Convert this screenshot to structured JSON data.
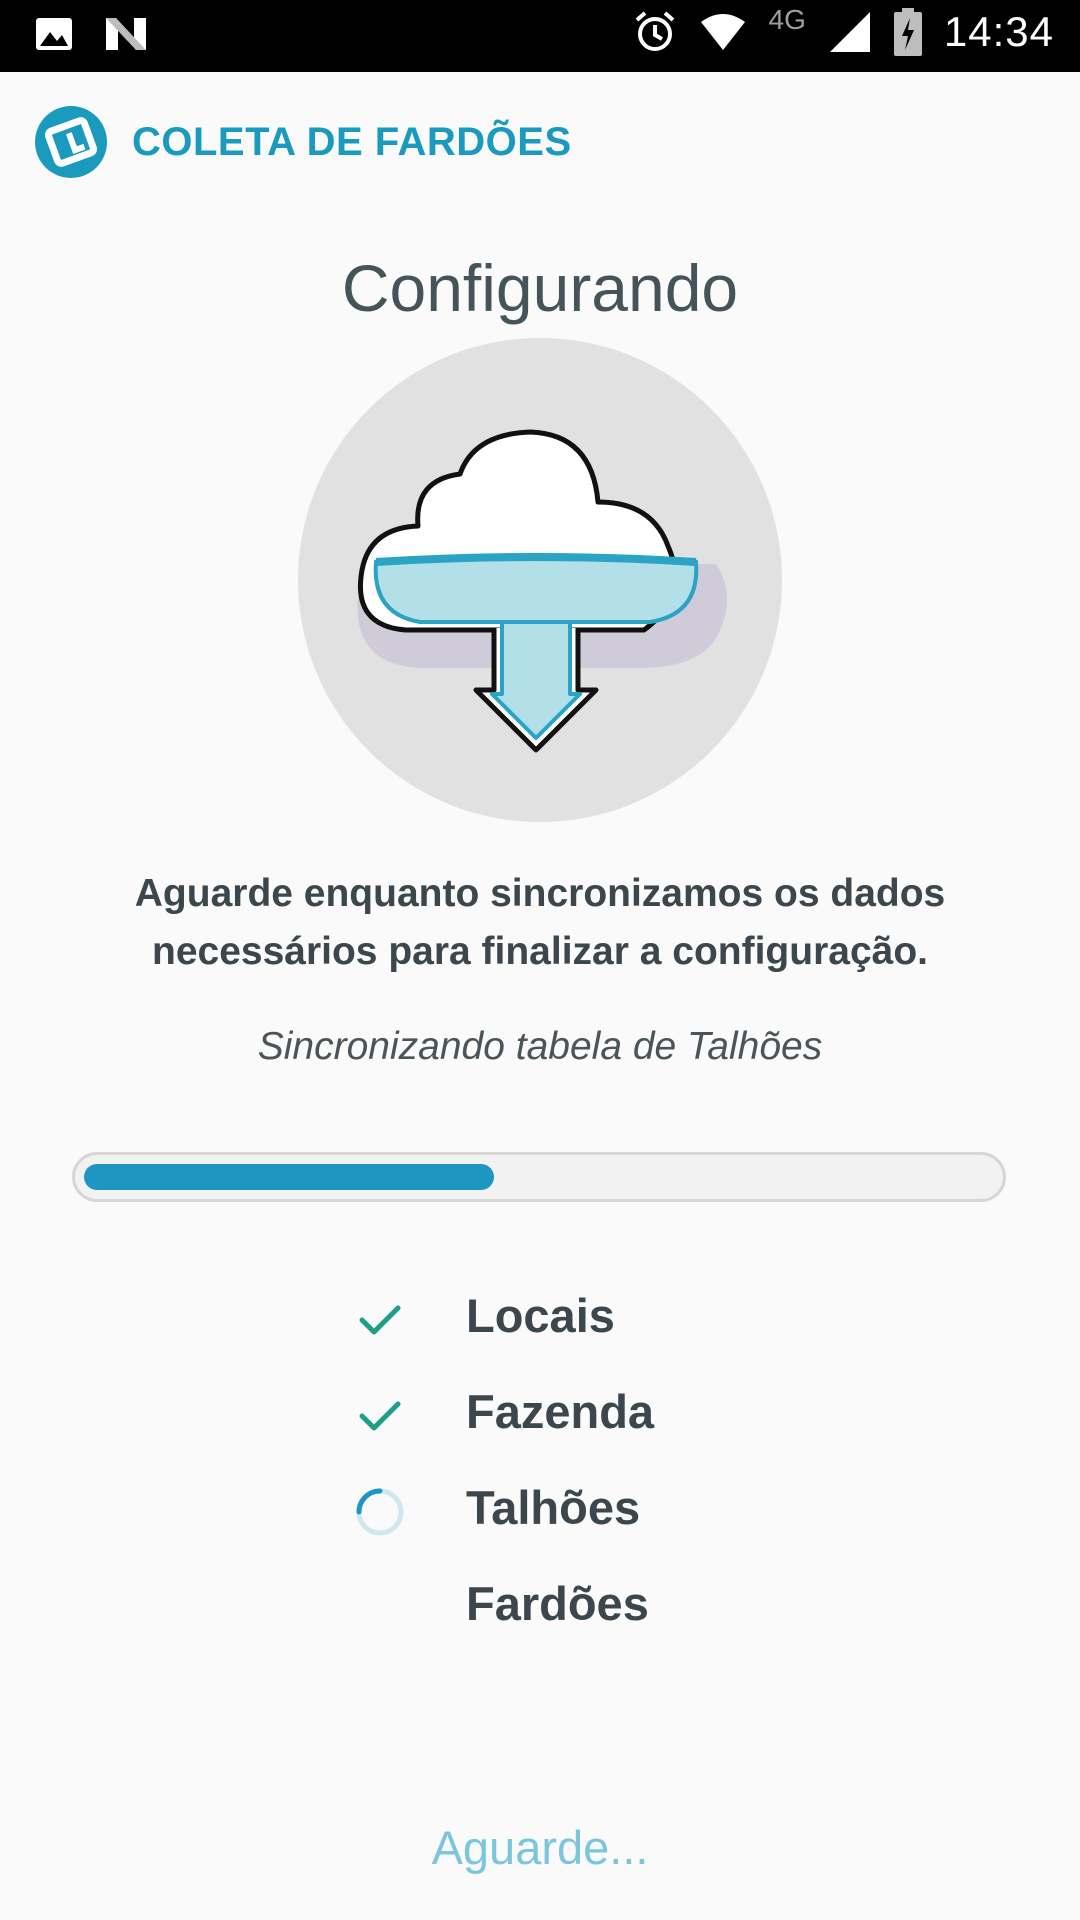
{
  "status_bar": {
    "time": "14:34",
    "network": "4G",
    "icons": [
      "gallery-icon",
      "n-notification-icon",
      "alarm-icon",
      "wifi-icon",
      "signal-icon",
      "battery-charging-icon"
    ]
  },
  "header": {
    "app_title": "COLETA DE FARDÕES",
    "logo_icon": "app-logo-icon"
  },
  "main": {
    "title": "Configurando",
    "illustration_icon": "cloud-download-icon",
    "description": "Aguarde enquanto sincronizamos os dados necessários para finalizar a configuração.",
    "sync_status": "Sincronizando tabela de Talhões",
    "progress_fraction": 0.45,
    "steps": [
      {
        "label": "Locais",
        "state": "done"
      },
      {
        "label": "Fazenda",
        "state": "done"
      },
      {
        "label": "Talhões",
        "state": "in-progress"
      },
      {
        "label": "Fardões",
        "state": "pending"
      }
    ]
  },
  "footer": {
    "wait_label": "Aguarde..."
  },
  "colors": {
    "accent": "#1a9bbe",
    "progress": "#1e96c1",
    "check": "#1aa084",
    "footer": "#7ac7dd"
  }
}
